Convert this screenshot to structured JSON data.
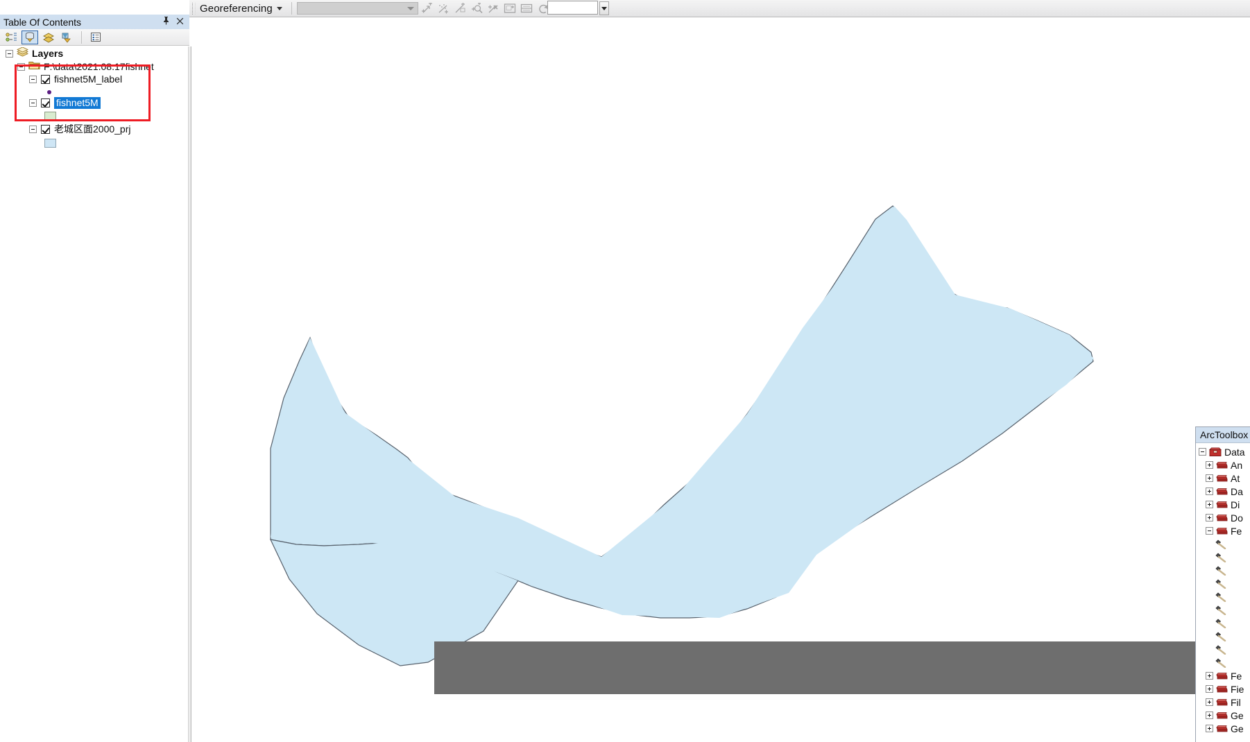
{
  "toolbar": {
    "georeferencing_label": "Georeferencing",
    "layer_combo_value": "",
    "value_box": "",
    "icons": [
      "add-control-points-icon",
      "auto-registration-icon",
      "view-link-table-icon",
      "zoom-link-icon",
      "delete-link-icon",
      "fit-to-display-icon",
      "rectify-icon",
      "rotate-icon"
    ]
  },
  "toc": {
    "title": "Table Of Contents",
    "pin_icon": "pin-icon",
    "close_icon": "close-icon",
    "toolbar_buttons": [
      {
        "name": "list-by-drawing-order-button",
        "label": "List By Drawing Order",
        "active": false
      },
      {
        "name": "list-by-source-button",
        "label": "List By Source",
        "active": true
      },
      {
        "name": "list-by-visibility-button",
        "label": "List By Visibility",
        "active": false
      },
      {
        "name": "list-by-selection-button",
        "label": "List By Selection",
        "active": false
      },
      {
        "name": "options-button",
        "label": "Options",
        "active": false
      }
    ],
    "tree": {
      "root": {
        "label": "Layers",
        "expanded": true
      },
      "workspace": {
        "label": "F:\\data\\2021.08.17fishnet",
        "expanded": true
      },
      "layers": [
        {
          "label": "fishnet5M_label",
          "checked": true,
          "expanded": true,
          "selected": false,
          "symbol": "point-symbol",
          "symbol_color": "#5b1d82"
        },
        {
          "label": "fishnet5M",
          "checked": true,
          "expanded": true,
          "selected": true,
          "symbol": "polygon-symbol",
          "symbol_color": "#d9ecd0"
        },
        {
          "label": "老城区面2000_prj",
          "checked": true,
          "expanded": true,
          "selected": false,
          "symbol": "polygon-symbol",
          "symbol_color": "#cfe6f5"
        }
      ]
    },
    "highlight_box_color": "#ee1c24"
  },
  "map": {
    "polygon_fill": "#cde7f5",
    "polygon_stroke": "#56606b",
    "gray_bar_color": "#6e6e6e",
    "background": "#ffffff"
  },
  "arctoolbox": {
    "title": "ArcToolbox",
    "rows": [
      {
        "label": "Data",
        "icon": "toolbox-icon",
        "expander": "minus",
        "indent": 0
      },
      {
        "label": "An",
        "icon": "toolset-icon",
        "expander": "plus",
        "indent": 1
      },
      {
        "label": "At",
        "icon": "toolset-icon",
        "expander": "plus",
        "indent": 1
      },
      {
        "label": "Da",
        "icon": "toolset-icon",
        "expander": "plus",
        "indent": 1
      },
      {
        "label": "Di",
        "icon": "toolset-icon",
        "expander": "plus",
        "indent": 1
      },
      {
        "label": "Do",
        "icon": "toolset-icon",
        "expander": "plus",
        "indent": 1
      },
      {
        "label": "Fe",
        "icon": "toolset-icon",
        "expander": "minus",
        "indent": 1
      },
      {
        "label": "",
        "icon": "hammer-icon",
        "expander": "none",
        "indent": 2
      },
      {
        "label": "",
        "icon": "hammer-icon",
        "expander": "none",
        "indent": 2
      },
      {
        "label": "",
        "icon": "hammer-icon",
        "expander": "none",
        "indent": 2
      },
      {
        "label": "",
        "icon": "hammer-icon",
        "expander": "none",
        "indent": 2
      },
      {
        "label": "",
        "icon": "hammer-icon",
        "expander": "none",
        "indent": 2
      },
      {
        "label": "",
        "icon": "hammer-icon",
        "expander": "none",
        "indent": 2
      },
      {
        "label": "",
        "icon": "hammer-icon",
        "expander": "none",
        "indent": 2
      },
      {
        "label": "",
        "icon": "hammer-icon",
        "expander": "none",
        "indent": 2
      },
      {
        "label": "",
        "icon": "hammer-icon",
        "expander": "none",
        "indent": 2
      },
      {
        "label": "Fe",
        "icon": "toolset-icon",
        "expander": "plus",
        "indent": 1
      },
      {
        "label": "Fie",
        "icon": "toolset-icon",
        "expander": "plus",
        "indent": 1
      },
      {
        "label": "Fil",
        "icon": "toolset-icon",
        "expander": "plus",
        "indent": 1
      },
      {
        "label": "Ge",
        "icon": "toolset-icon",
        "expander": "plus",
        "indent": 1
      },
      {
        "label": "Ge",
        "icon": "toolset-icon",
        "expander": "plus",
        "indent": 1
      }
    ]
  }
}
